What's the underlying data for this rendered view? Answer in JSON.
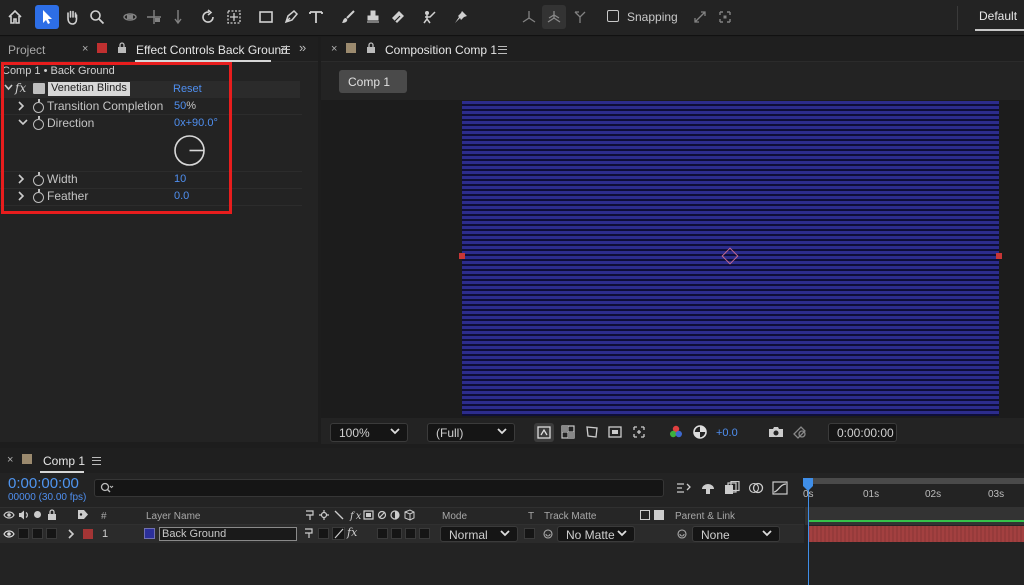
{
  "toolbar": {
    "tools": [
      "home-icon",
      "selection-tool-icon",
      "hand-tool-icon",
      "zoom-tool-icon",
      "orbit-camera-icon",
      "pan-camera-icon",
      "dolly-camera-icon",
      "rotation-tool-icon",
      "pan-behind-icon",
      "rectangle-tool-icon",
      "pen-tool-icon",
      "type-tool-icon",
      "brush-tool-icon",
      "clone-stamp-icon",
      "eraser-tool-icon",
      "roto-brush-icon",
      "puppet-pin-icon"
    ],
    "snapping_label": "Snapping",
    "workspace_label": "Default"
  },
  "left_panel": {
    "project_tab": "Project",
    "effect_controls_tab": "Effect Controls Back Ground",
    "breadcrumb": "Comp 1 • Back Ground",
    "effect": {
      "fx_label": "fx",
      "name": "Venetian Blinds",
      "reset": "Reset"
    },
    "props": {
      "transition": {
        "label": "Transition Completion",
        "value": "50",
        "unit": "%"
      },
      "direction": {
        "label": "Direction",
        "value": "0x+90.0°"
      },
      "width": {
        "label": "Width",
        "value": "10"
      },
      "feather": {
        "label": "Feather",
        "value": "0.0"
      }
    }
  },
  "comp_panel": {
    "tab_label": "Composition Comp 1",
    "comp_chip": "Comp 1",
    "zoom": "100%",
    "resolution": "(Full)",
    "exposure": "+0.0",
    "timecode": "0:00:00:00",
    "canvas_color": "#2c2c8c"
  },
  "timeline": {
    "tab_label": "Comp 1",
    "timecode": "0:00:00:00",
    "fps": "00000 (30.00 fps)",
    "headers": {
      "hash": "#",
      "layer_name": "Layer Name",
      "mode": "Mode",
      "t": "T",
      "track_matte": "Track Matte",
      "parent_link": "Parent & Link"
    },
    "layer": {
      "index": "1",
      "name": "Back Ground",
      "mode": "Normal",
      "matte": "No Matte",
      "parent": "None"
    },
    "ruler": [
      "0s",
      "01s",
      "02s",
      "03s"
    ]
  }
}
